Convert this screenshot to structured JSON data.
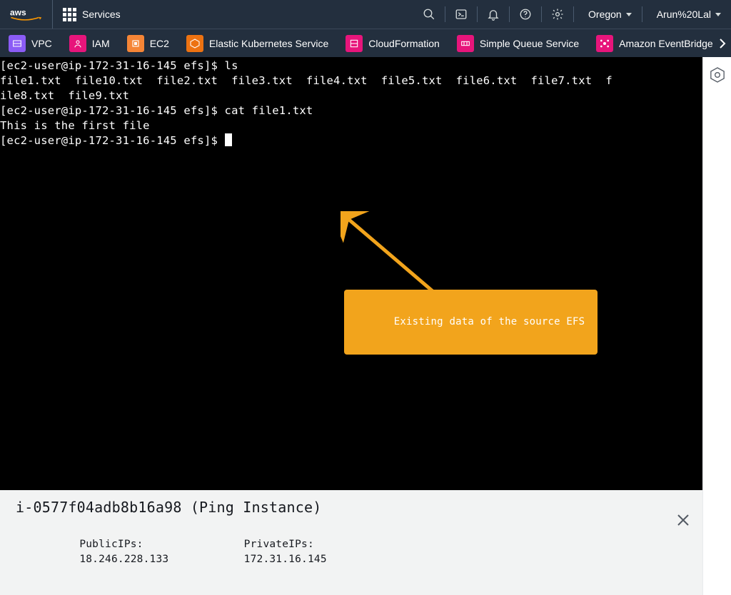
{
  "topnav": {
    "services_label": "Services",
    "region": "Oregon",
    "user": "Arun%20Lal"
  },
  "service_bar": [
    {
      "name": "VPC",
      "color": "c-purple"
    },
    {
      "name": "IAM",
      "color": "c-red"
    },
    {
      "name": "EC2",
      "color": "c-orange"
    },
    {
      "name": "Elastic Kubernetes Service",
      "color": "c-orange2"
    },
    {
      "name": "CloudFormation",
      "color": "c-pinkish"
    },
    {
      "name": "Simple Queue Service",
      "color": "c-pinkish"
    },
    {
      "name": "Amazon EventBridge",
      "color": "c-pinkish"
    }
  ],
  "terminal": {
    "lines": [
      "[ec2-user@ip-172-31-16-145 efs]$ ls",
      "file1.txt  file10.txt  file2.txt  file3.txt  file4.txt  file5.txt  file6.txt  file7.txt  f",
      "ile8.txt  file9.txt",
      "[ec2-user@ip-172-31-16-145 efs]$ cat file1.txt",
      "This is the first file",
      "[ec2-user@ip-172-31-16-145 efs]$ "
    ]
  },
  "annotation": {
    "label": "Existing data of the source EFS",
    "arrow_color": "#f2a41c"
  },
  "instance_bar": {
    "title": "i-0577f04adb8b16a98 (Ping Instance)",
    "public_label": "PublicIPs:",
    "public_value": "18.246.228.133",
    "private_label": "PrivateIPs:",
    "private_value": "172.31.16.145"
  }
}
